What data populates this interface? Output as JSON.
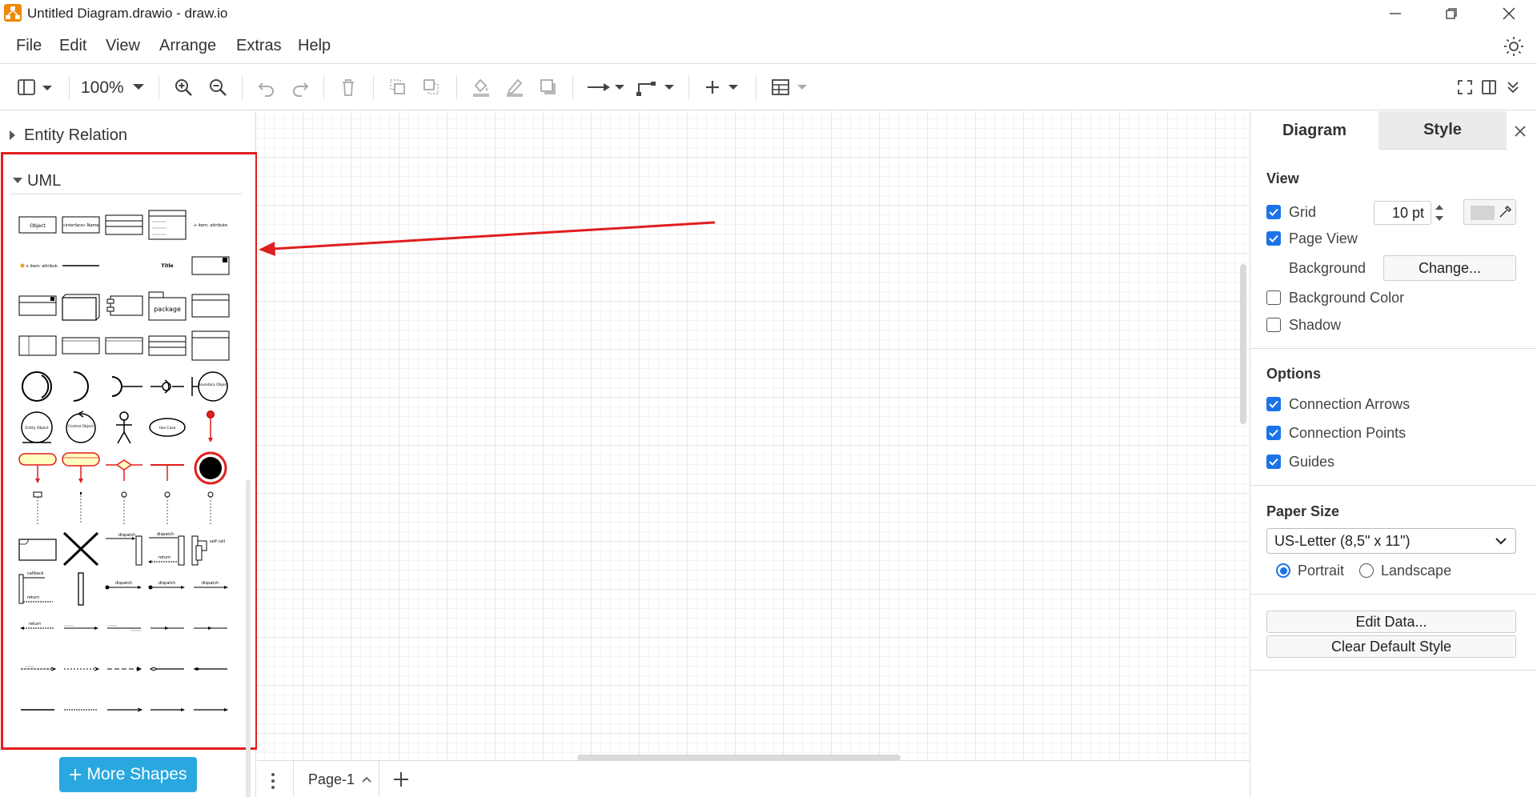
{
  "window": {
    "title": "Untitled Diagram.drawio - draw.io",
    "controls": [
      "minimize-icon",
      "restore-icon",
      "close-icon"
    ]
  },
  "menu": {
    "items": [
      "File",
      "Edit",
      "View",
      "Arrange",
      "Extras",
      "Help"
    ]
  },
  "toolbar": {
    "zoom": "100%"
  },
  "sidebar": {
    "sections": [
      {
        "label": "Entity Relation",
        "expanded": false
      },
      {
        "label": "UML",
        "expanded": true
      }
    ],
    "uml_shape_labels": {
      "object": "Object",
      "interface": "«interface» Name",
      "item_attribute": "+ item: attribute",
      "title": "Title",
      "package": "package",
      "boundary": "Boundary Object",
      "entity": "Entity Object",
      "control": "Control Object",
      "use_case": "Use Case",
      "dispatch": "dispatch",
      "return": "return",
      "self_call": "self call",
      "callback": "callback"
    },
    "more_shapes_label": "More Shapes"
  },
  "canvas": {
    "annotation_color": "#e01e1e"
  },
  "pagebar": {
    "page_tab": "Page-1"
  },
  "panel": {
    "tabs": {
      "diagram": "Diagram",
      "style": "Style"
    },
    "view": {
      "heading": "View",
      "grid_label": "Grid",
      "grid_checked": true,
      "grid_size": "10 pt",
      "page_view_label": "Page View",
      "page_view_checked": true,
      "background_label": "Background",
      "change_button": "Change...",
      "bg_color_label": "Background Color",
      "bg_color_checked": false,
      "shadow_label": "Shadow",
      "shadow_checked": false
    },
    "options": {
      "heading": "Options",
      "connection_arrows": "Connection Arrows",
      "connection_points": "Connection Points",
      "guides": "Guides"
    },
    "paper": {
      "heading": "Paper Size",
      "selected": "US-Letter (8,5\" x 11\")",
      "portrait": "Portrait",
      "landscape": "Landscape",
      "orientation": "Portrait"
    },
    "edit_data_button": "Edit Data...",
    "clear_style_button": "Clear Default Style"
  },
  "colors": {
    "accent": "#1a73e8",
    "more_shapes": "#29a8e0",
    "highlight": "#e01e1e",
    "app_icon": "#f08705"
  }
}
